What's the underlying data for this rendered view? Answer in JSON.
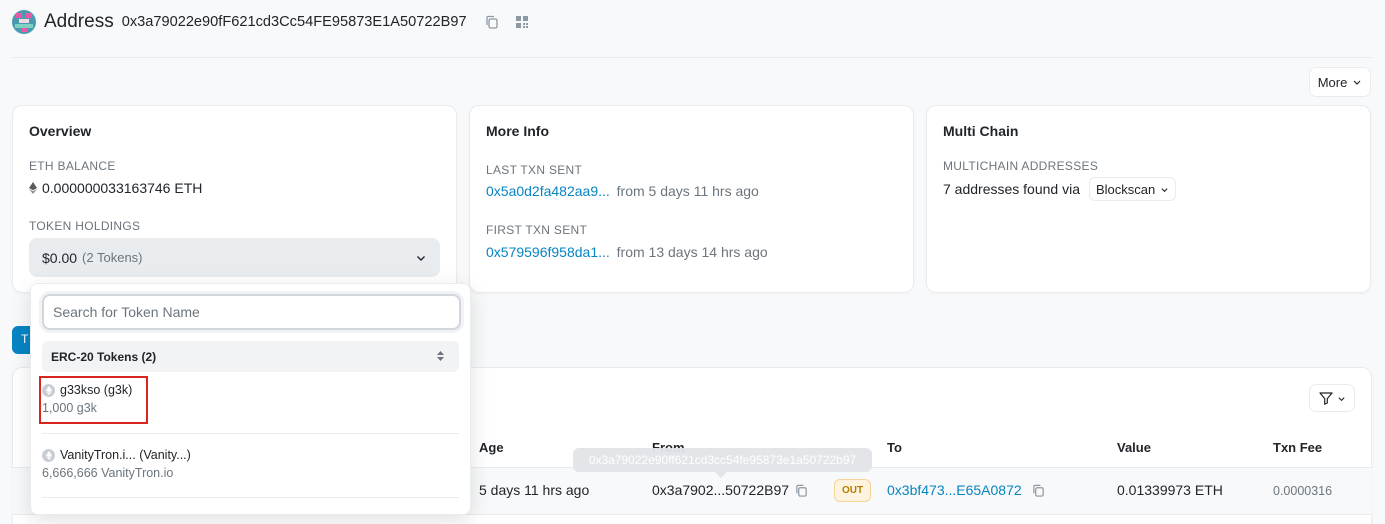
{
  "header": {
    "title": "Address",
    "address": "0x3a79022e90fF621cd3Cc54FE95873E1A50722B97"
  },
  "more_button": "More",
  "overview": {
    "title": "Overview",
    "eth_balance_label": "ETH BALANCE",
    "eth_balance_value": "0.000000033163746 ETH",
    "token_holdings_label": "TOKEN HOLDINGS",
    "token_holdings_amount": "$0.00",
    "token_holdings_count": "(2 Tokens)"
  },
  "more_info": {
    "title": "More Info",
    "last_txn_label": "LAST TXN SENT",
    "last_txn_hash": "0x5a0d2fa482aa9...",
    "last_txn_time": "from 5 days 11 hrs ago",
    "first_txn_label": "FIRST TXN SENT",
    "first_txn_hash": "0x579596f958da1...",
    "first_txn_time": "from 13 days 14 hrs ago"
  },
  "multi_chain": {
    "title": "Multi Chain",
    "label": "MULTICHAIN ADDRESSES",
    "text": "7 addresses found via",
    "chip": "Blockscan"
  },
  "tab_fragment": "T",
  "token_dropdown": {
    "search_placeholder": "Search for Token Name",
    "group_label": "ERC-20 Tokens (2)",
    "tokens": [
      {
        "name": "g33kso (g3k)",
        "balance": "1,000 g3k"
      },
      {
        "name": "VanityTron.i... (Vanity...)",
        "balance": "6,666,666 VanityTron.io"
      }
    ]
  },
  "table": {
    "headers": {
      "age": "Age",
      "from": "From",
      "to": "To",
      "value": "Value",
      "txn_fee": "Txn Fee"
    },
    "row": {
      "age": "5 days 11 hrs ago",
      "from": "0x3a7902...50722B97",
      "direction": "OUT",
      "to": "0x3bf473...E65A0872",
      "value": "0.01339973 ETH",
      "fee": "0.0000316"
    },
    "tooltip": "0x3a79022e90ff621cd3cc54fe95873e1a50722b97"
  },
  "colors": {
    "link": "#0784c3",
    "highlight": "#d9251d"
  }
}
